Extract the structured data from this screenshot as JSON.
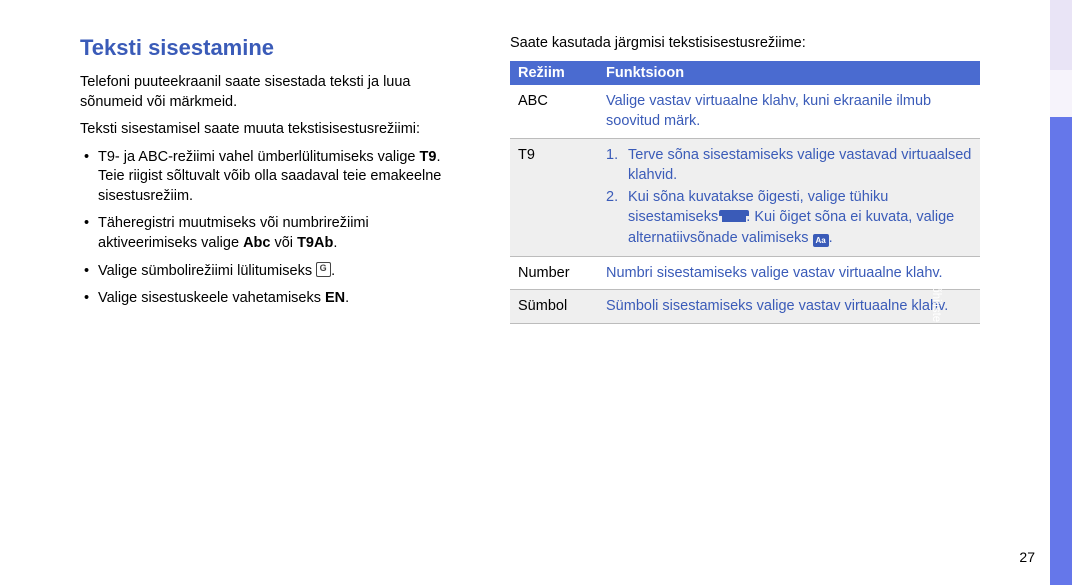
{
  "title": "Teksti sisestamine",
  "para1": "Telefoni puuteekraanil saate sisestada teksti ja luua sõnumeid või märkmeid.",
  "para2": "Teksti sisestamisel saate muuta tekstisisestusrežiimi:",
  "bullets": [
    {
      "pre": "T9- ja ABC-režiimi vahel ümberlülitumiseks valige ",
      "bold": "T9",
      "post": ". Teie riigist sõltuvalt võib olla saadaval teie emakeelne sisestusrežiim."
    },
    {
      "pre": "Täheregistri muutmiseks või numbrirežiimi aktiveerimiseks valige ",
      "bold": "Abc",
      "mid": " või ",
      "bold2": "T9Ab",
      "post": "."
    },
    {
      "pre": "Valige sümbolirežiimi lülitumiseks ",
      "icon": "symbol",
      "post": "."
    },
    {
      "pre": "Valige sisestuskeele vahetamiseks ",
      "bold": "EN",
      "post": "."
    }
  ],
  "rightIntro": "Saate kasutada järgmisi tekstisisestusrežiime:",
  "table": {
    "head": {
      "mode": "Režiim",
      "func": "Funktsioon"
    },
    "rows": [
      {
        "mode": "ABC",
        "func": "Valige vastav virtuaalne klahv, kuni ekraanile ilmub soovitud märk.",
        "alt": false
      },
      {
        "mode": "T9",
        "steps": [
          "Terve sõna sisestamiseks valige vastavad virtuaalsed klahvid.",
          {
            "pre": "Kui sõna kuvatakse õigesti, valige tühiku sisestamiseks ",
            "icon": "space",
            "mid": ". Kui õiget sõna ei kuvata, valige alternatiivsõnade valimiseks ",
            "icon2": "aa",
            "post": "."
          }
        ],
        "alt": true
      },
      {
        "mode": "Number",
        "func": "Numbri sisestamiseks valige vastav virtuaalne klahv.",
        "alt": false
      },
      {
        "mode": "Sümbol",
        "func": "Sümboli sisestamiseks valige vastav virtuaalne klahv.",
        "alt": true
      }
    ]
  },
  "sideTab": "põhiliste funktsioonide kasutamine",
  "pageNumber": "27"
}
